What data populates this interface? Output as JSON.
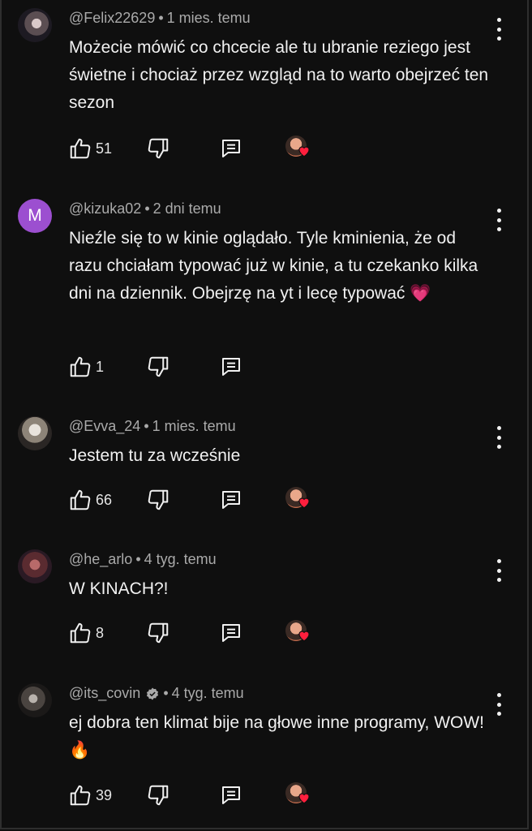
{
  "colors": {
    "background": "#0f0f0f",
    "text_primary": "#f1f1f1",
    "text_secondary": "#aaaaaa",
    "heart_red": "#ff1f3d",
    "letter_avatar_bg": "#9c4fd0"
  },
  "comments": [
    {
      "author": "@Felix22629",
      "separator": "•",
      "time": "1 mies. temu",
      "text": "Możecie mówić co chcecie ale tu ubranie reziego jest świetne i chociaż przez wzgląd na to warto obejrzeć ten sezon",
      "likes": "51",
      "creator_heart": true
    },
    {
      "author": "@kizuka02",
      "separator": "•",
      "time": "2 dni temu",
      "avatar_letter": "M",
      "text": "Nieźle się to w kinie oglądało. Tyle kminienia, że od razu chciałam typować już w kinie, a tu czekanko kilka dni na dziennik. Obejrzę na yt i lecę typować 💗",
      "likes": "1",
      "creator_heart": false
    },
    {
      "author": "@Evva_24",
      "separator": "•",
      "time": "1 mies. temu",
      "text": "Jestem tu za wcześnie",
      "likes": "66",
      "creator_heart": true
    },
    {
      "author": "@he_arlo",
      "separator": "•",
      "time": "4 tyg. temu",
      "text": "W KINACH?!",
      "likes": "8",
      "creator_heart": true
    },
    {
      "author": "@its_covin",
      "separator": "•",
      "time": "4 tyg. temu",
      "verified_icon": "verified-badge-icon",
      "text": "ej dobra ten klimat bije na głowe inne programy, WOW! 🔥",
      "likes": "39",
      "creator_heart": true
    }
  ]
}
